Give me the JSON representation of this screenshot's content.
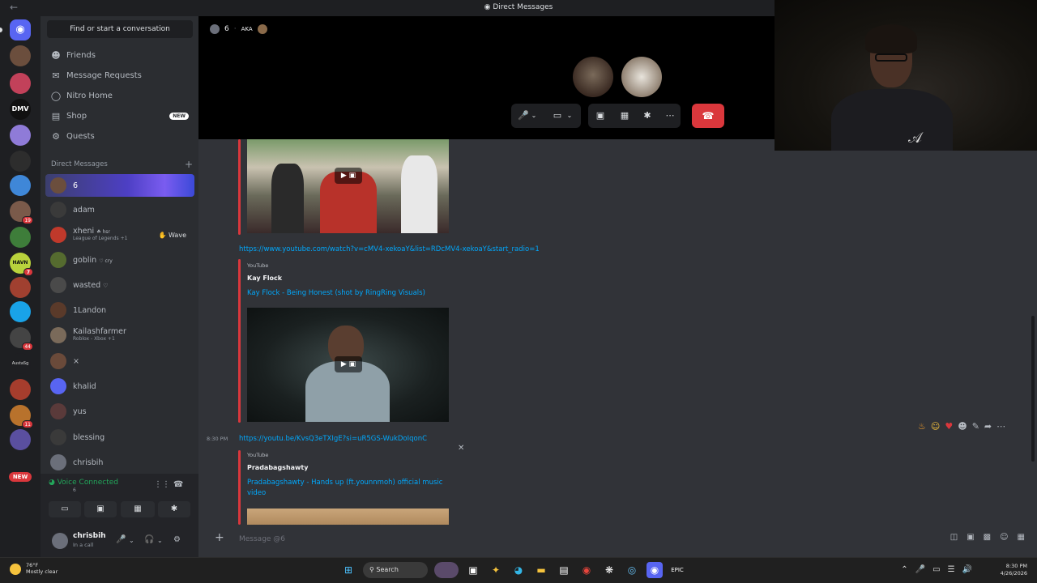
{
  "window": {
    "title": "Direct Messages"
  },
  "sidebar": {
    "find_placeholder": "Find or start a conversation",
    "nav": [
      {
        "label": "Friends",
        "icon": "friends-icon"
      },
      {
        "label": "Message Requests",
        "icon": "envelope-icon"
      },
      {
        "label": "Nitro Home",
        "icon": "nitro-icon"
      },
      {
        "label": "Shop",
        "icon": "shop-icon",
        "tag": "NEW"
      },
      {
        "label": "Quests",
        "icon": "quests-icon"
      }
    ],
    "dm_header": "Direct Messages",
    "dms": [
      {
        "name": "6",
        "sub": ""
      },
      {
        "name": "adam",
        "sub": ""
      },
      {
        "name": "xheni",
        "tag": "☘ hsr",
        "sub": "League of Legends +1",
        "action": "Wave"
      },
      {
        "name": "goblin",
        "tag": "♡ cry",
        "sub": ""
      },
      {
        "name": "wasted",
        "tag": "♡",
        "sub": ""
      },
      {
        "name": "1Landon",
        "sub": ""
      },
      {
        "name": "Kailashfarmer",
        "sub": "Roblox - Xbox +1"
      },
      {
        "name": "×",
        "sub": ""
      },
      {
        "name": "khalid",
        "sub": ""
      },
      {
        "name": "yus",
        "sub": ""
      },
      {
        "name": "blessing",
        "sub": ""
      },
      {
        "name": "chrisbih",
        "sub": ""
      }
    ]
  },
  "guild_badges": {
    "new": "NEW"
  },
  "voice": {
    "status": "Voice Connected",
    "channel": "6"
  },
  "user": {
    "name": "chrisbih",
    "status": "In a call"
  },
  "call": {
    "channel_name": "6",
    "nickname": "AKA"
  },
  "messages": {
    "link1": "https://www.youtube.com/watch?v=cMV4-xekoaY&list=RDcMV4-xekoaY&start_radio=1",
    "embed1": {
      "provider": "YouTube",
      "author": "Kay Flock",
      "title": "Kay Flock - Being Honest (shot by  RingRing Visuals)"
    },
    "timestamp": "8:30 PM",
    "link2": "https://youtu.be/KvsQ3eTXIgE?si=uR5GS-WukDoIqonC",
    "embed2": {
      "provider": "YouTube",
      "author": "Pradabagshawty",
      "title": "Pradabagshawty - Hands up (ft.younnmoh) official music video"
    }
  },
  "composer": {
    "placeholder": "Message @6"
  },
  "taskbar": {
    "weather_temp": "76°F",
    "weather_desc": "Mostly clear",
    "search_label": "Search",
    "time": "8:30 PM",
    "date": "4/26/2026"
  },
  "colors": {
    "accent": "#5865f2",
    "danger": "#da373c",
    "online": "#23a55a",
    "link": "#00a8fc"
  }
}
